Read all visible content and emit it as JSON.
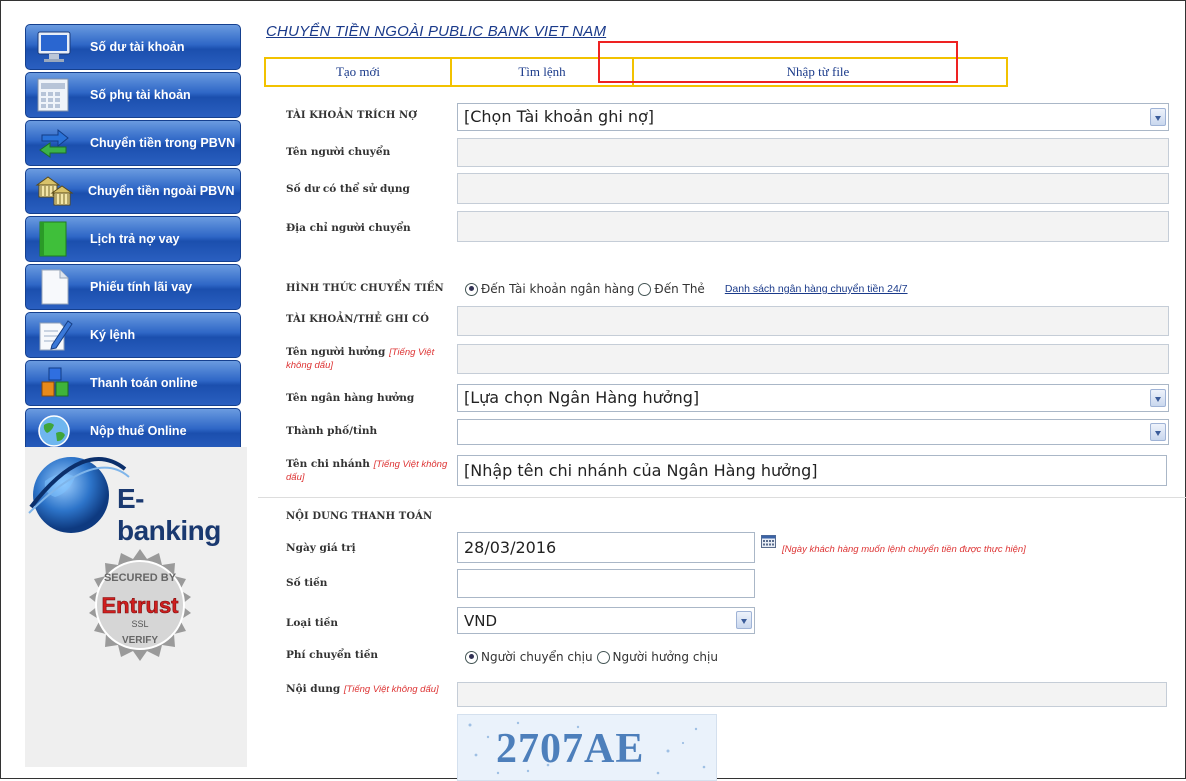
{
  "sidebar": {
    "items": [
      {
        "label": "Số dư tài khoản",
        "icon": "monitor-icon"
      },
      {
        "label": "Số phụ tài khoản",
        "icon": "calculator-icon"
      },
      {
        "label": "Chuyển tiền trong PBVN",
        "icon": "transfer-arrows-icon"
      },
      {
        "label": "Chuyển tiền ngoài PBVN",
        "icon": "bank-building-icon"
      },
      {
        "label": "Lịch trả nợ vay",
        "icon": "green-book-icon"
      },
      {
        "label": "Phiếu tính lãi vay",
        "icon": "document-icon"
      },
      {
        "label": "Ký lệnh",
        "icon": "pen-sign-icon"
      },
      {
        "label": "Thanh toán online",
        "icon": "cubes-icon"
      },
      {
        "label": "Nộp thuế Online",
        "icon": "globe-icon"
      }
    ],
    "logo_text": "E-banking",
    "seal_text": "SECURED BY Entrust SSL VERIFY"
  },
  "page": {
    "title": "CHUYỂN TIỀN NGOÀI PUBLIC BANK VIET NAM"
  },
  "tabs": [
    "Tạo mới",
    "Tìm lệnh",
    "Nhập từ file"
  ],
  "form": {
    "debit_account_label": "TÀI KHOẢN TRÍCH NỢ",
    "debit_account_value": "[Chọn Tài khoản ghi nợ]",
    "sender_name_label": "Tên người chuyển",
    "available_balance_label": "Số dư có thể sử dụng",
    "sender_address_label": "Địa chỉ người chuyển",
    "transfer_type_label": "HÌNH THỨC CHUYỂN TIỀN",
    "transfer_type_options": [
      "Đến Tài khoản ngân hàng",
      "Đến Thẻ"
    ],
    "bank_list_link": "Danh sách ngân hàng chuyển tiền 24/7",
    "credit_account_label": "TÀI KHOẢN/THẺ GHI CÓ",
    "beneficiary_name_label": "Tên người hưởng",
    "beneficiary_name_hint": "[Tiếng Việt không dấu]",
    "beneficiary_bank_label": "Tên ngân hàng hưởng",
    "beneficiary_bank_value": "[Lựa chọn Ngân Hàng hưởng]",
    "city_label": "Thành phố/tỉnh",
    "branch_label": "Tên chi nhánh",
    "branch_hint": "[Tiếng Việt không dấu]",
    "branch_value": "[Nhập tên chi nhánh của Ngân Hàng hưởng]",
    "payment_section_label": "NỘI DUNG THANH TOÁN",
    "value_date_label": "Ngày giá trị",
    "value_date": "28/03/2016",
    "value_date_hint": "[Ngày khách hàng muốn lệnh chuyển tiền được thực hiện]",
    "amount_label": "Số tiền",
    "currency_label": "Loại tiền",
    "currency_value": "VND",
    "fee_label": "Phí chuyển tiền",
    "fee_options": [
      "Người chuyển chịu",
      "Người hưởng chịu"
    ],
    "content_label": "Nội dung",
    "content_hint": "[Tiếng Việt không dấu]",
    "captcha": "2707AE"
  }
}
